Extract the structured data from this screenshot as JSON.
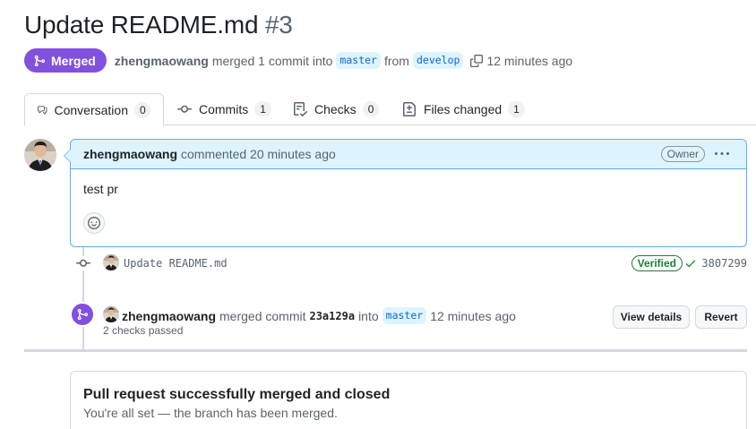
{
  "pr": {
    "title": "Update README.md",
    "number": "#3",
    "state_label": "Merged",
    "author": "zhengmaowang",
    "merged_text": "merged 1 commit into",
    "base_branch": "master",
    "from_text": "from",
    "head_branch": "develop",
    "time": "12 minutes ago"
  },
  "tabs": [
    {
      "label": "Conversation",
      "count": "0",
      "icon": "comment-discussion-icon"
    },
    {
      "label": "Commits",
      "count": "1",
      "icon": "git-commit-icon"
    },
    {
      "label": "Checks",
      "count": "0",
      "icon": "checklist-icon"
    },
    {
      "label": "Files changed",
      "count": "1",
      "icon": "file-diff-icon"
    }
  ],
  "comment": {
    "author": "zhengmaowang",
    "action_text": "commented 20 minutes ago",
    "role_label": "Owner",
    "body": "test pr"
  },
  "commit": {
    "message": "Update README.md",
    "verified_label": "Verified",
    "sha": "3807299"
  },
  "merge_event": {
    "author": "zhengmaowang",
    "text_1": "merged commit",
    "sha": "23a129a",
    "text_2": "into",
    "branch": "master",
    "time": "12 minutes ago",
    "checks_text": "2 checks passed",
    "view_details_label": "View details",
    "revert_label": "Revert"
  },
  "merged_box": {
    "title": "Pull request successfully merged and closed",
    "subtitle": "You're all set — the branch has been merged."
  },
  "colors": {
    "merged_purple": "#8250df",
    "link_blue": "#0969da",
    "highlight_bg": "#ddf4ff",
    "success_green": "#1a7f37"
  }
}
